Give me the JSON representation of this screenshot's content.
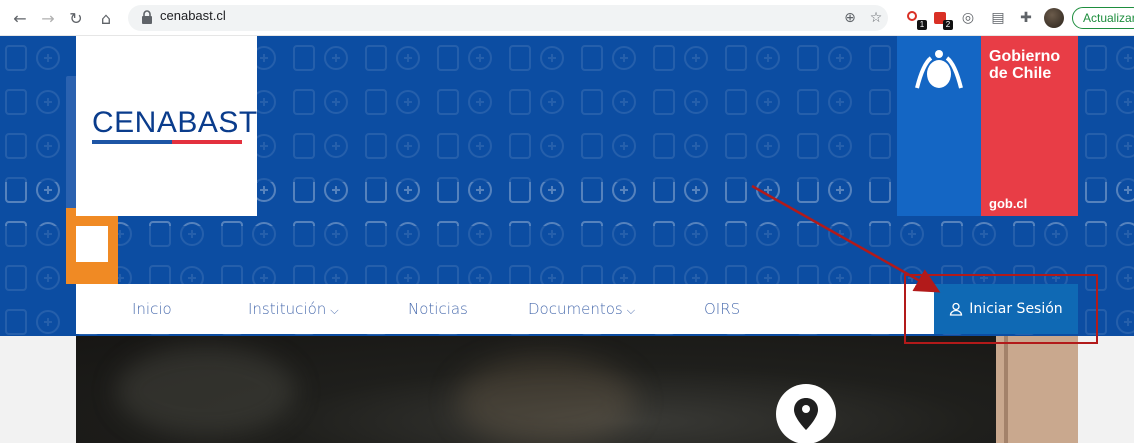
{
  "browser": {
    "url": "cenabast.cl",
    "update_label": "Actualizar",
    "extension_badges": [
      "1",
      "2"
    ],
    "icons": [
      "back-arrow-icon",
      "forward-arrow-icon",
      "reload-icon",
      "home-icon",
      "lock-icon",
      "zoom-icon",
      "star-icon",
      "puzzle-icon"
    ]
  },
  "header": {
    "logo_text": "CENABAST",
    "gob_title": "Gobierno de Chile",
    "gob_url": "gob.cl"
  },
  "nav": {
    "items": [
      {
        "label": "Inicio"
      },
      {
        "label": "Institución",
        "has_dropdown": true
      },
      {
        "label": "Noticias"
      },
      {
        "label": "Documentos",
        "has_dropdown": true
      },
      {
        "label": "OIRS"
      }
    ],
    "login_label": "Iniciar Sesión"
  },
  "colors": {
    "hero_blue": "#0c4da2",
    "nav_text": "#4a6cae",
    "login_bg": "#0f69b4",
    "gob_red": "#e83d46",
    "gob_blue": "#1466c4",
    "annotation_red": "#b21a1a"
  }
}
